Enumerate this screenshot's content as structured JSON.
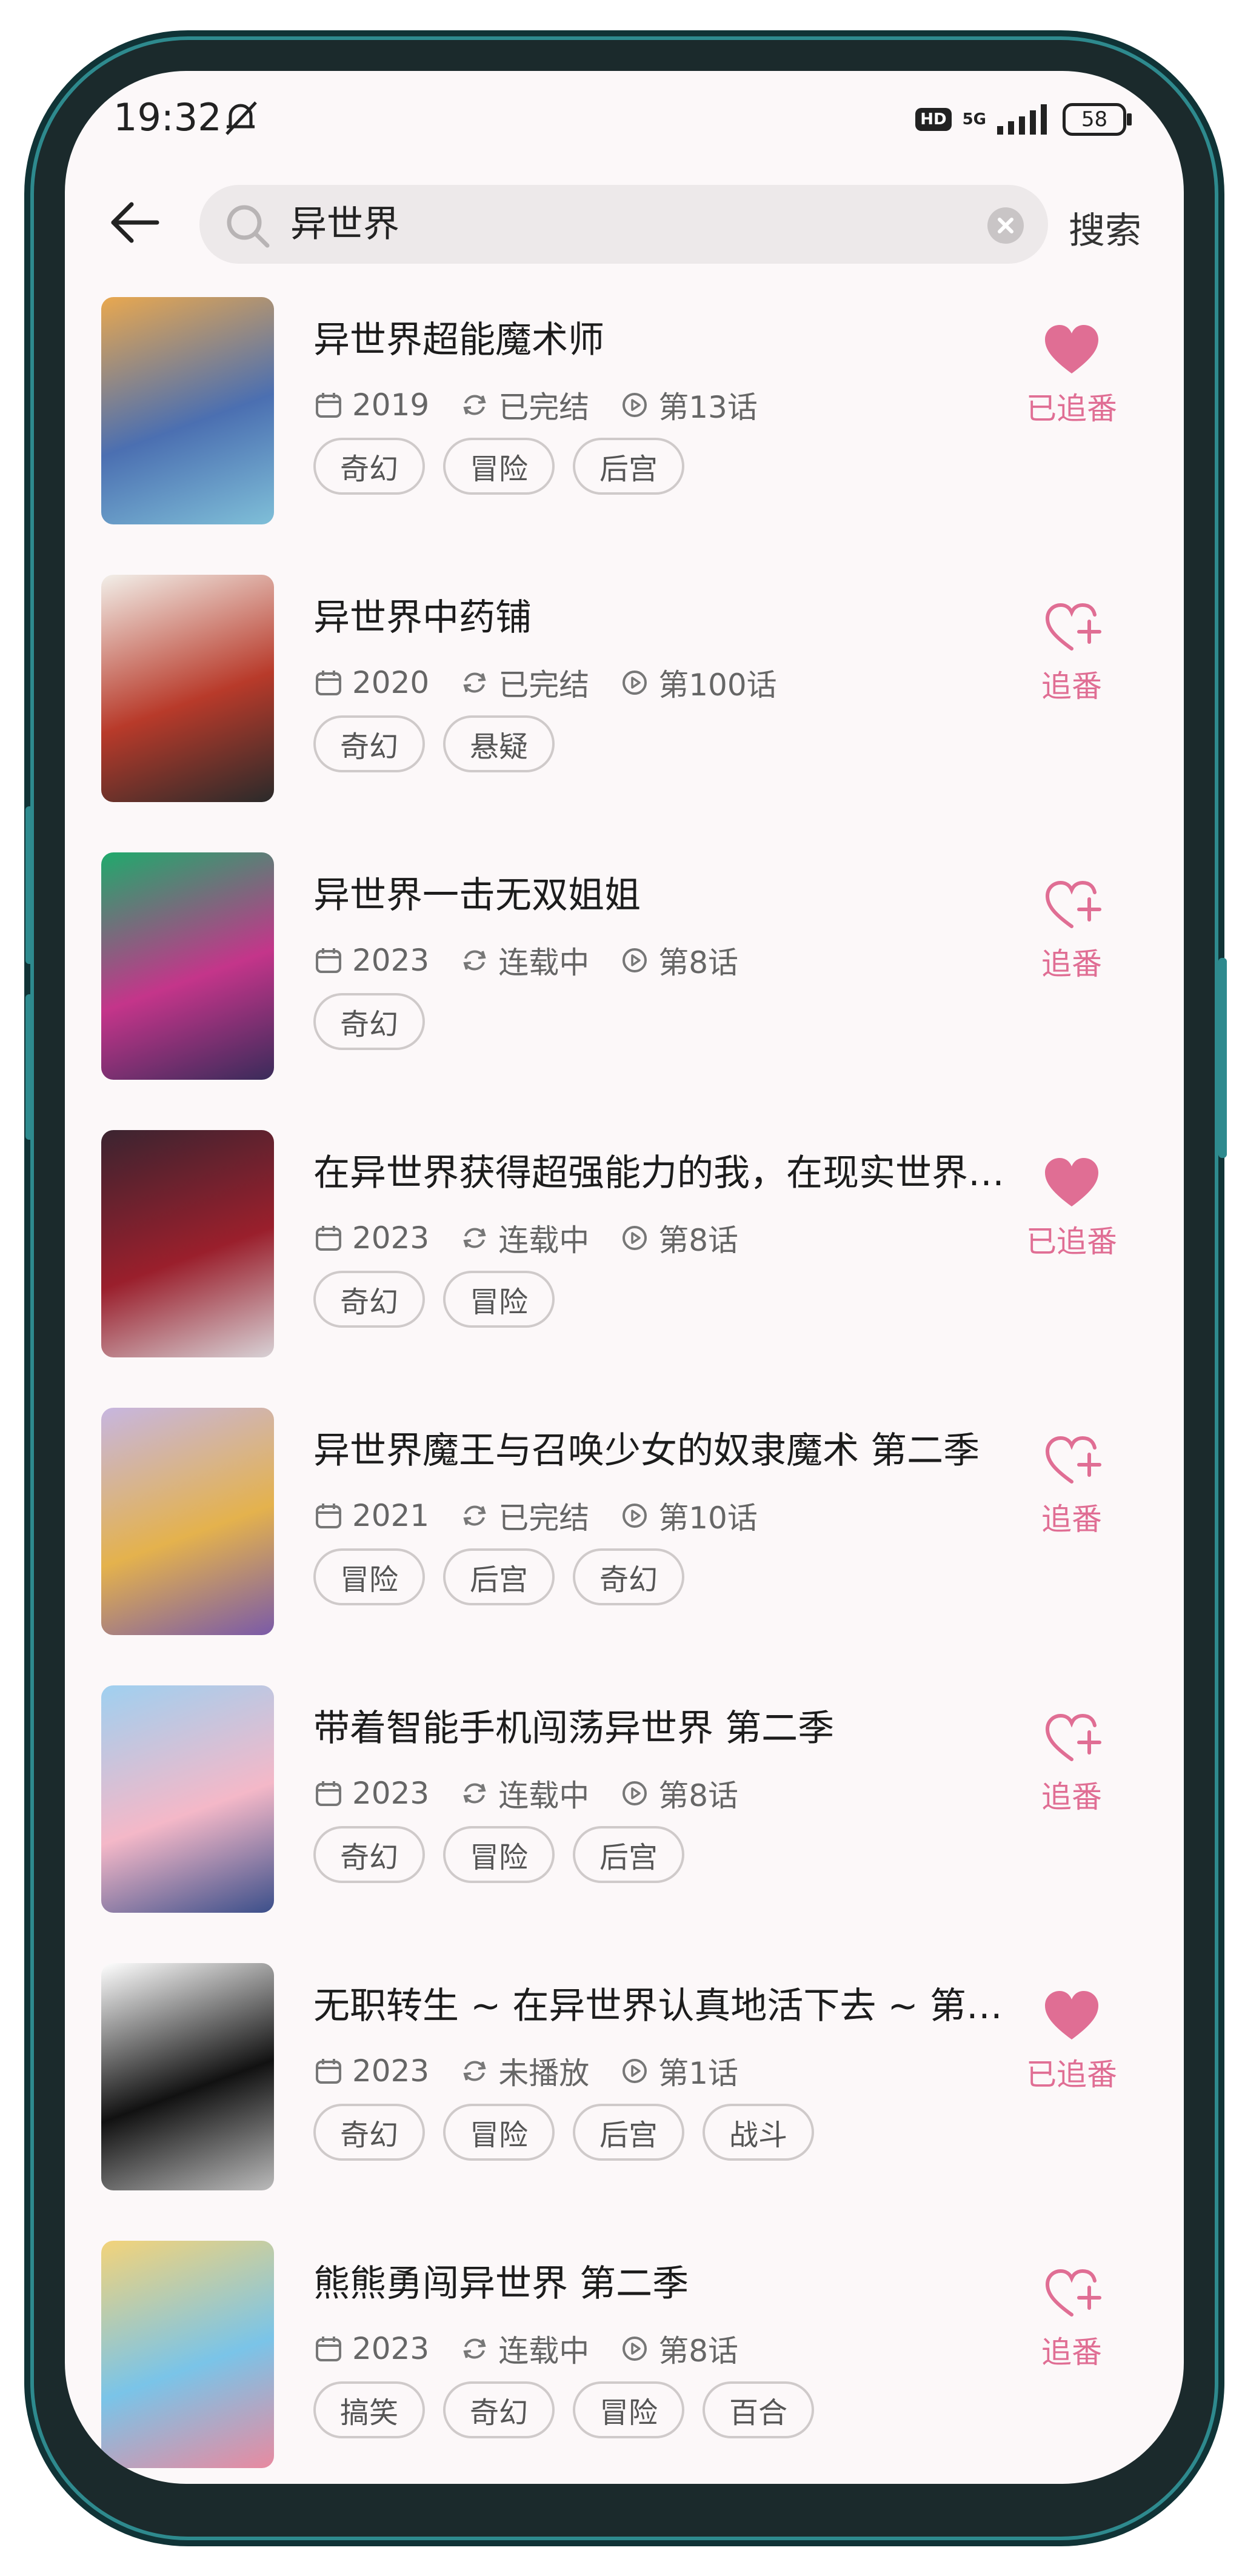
{
  "status_bar": {
    "time": "19:32",
    "network": "5G",
    "hd": "HD",
    "battery": "58"
  },
  "search": {
    "query": "异世界",
    "button": "搜索"
  },
  "accent_color": "#e06e94",
  "results": [
    {
      "title": "异世界超能魔术师",
      "year": "2019",
      "status": "已完结",
      "episode": "第13话",
      "tags": [
        "奇幻",
        "冒险",
        "后宫"
      ],
      "followed": true,
      "follow_label": "已追番",
      "cover_colors": [
        "#e9a84f",
        "#4b6fb1",
        "#7fbfd8"
      ]
    },
    {
      "title": "异世界中药铺",
      "year": "2020",
      "status": "已完结",
      "episode": "第100话",
      "tags": [
        "奇幻",
        "悬疑"
      ],
      "followed": false,
      "follow_label": "追番",
      "cover_colors": [
        "#f2efe9",
        "#b83a2a",
        "#2a2a2a"
      ]
    },
    {
      "title": "异世界一击无双姐姐",
      "year": "2023",
      "status": "连载中",
      "episode": "第8话",
      "tags": [
        "奇幻"
      ],
      "followed": false,
      "follow_label": "追番",
      "cover_colors": [
        "#1faa6c",
        "#c4358a",
        "#3a2b5a"
      ]
    },
    {
      "title": "在异世界获得超强能力的我，在现实世界照样无敌～等级提升改变人生命运～",
      "year": "2023",
      "status": "连载中",
      "episode": "第8话",
      "tags": [
        "奇幻",
        "冒险"
      ],
      "followed": true,
      "follow_label": "已追番",
      "cover_colors": [
        "#3b2430",
        "#9a1f2c",
        "#d8d2d6"
      ]
    },
    {
      "title": "异世界魔王与召唤少女的奴隶魔术 第二季",
      "year": "2021",
      "status": "已完结",
      "episode": "第10话",
      "tags": [
        "冒险",
        "后宫",
        "奇幻"
      ],
      "followed": false,
      "follow_label": "追番",
      "cover_colors": [
        "#c7b6e0",
        "#e4b24d",
        "#7a5aa8"
      ]
    },
    {
      "title": "带着智能手机闯荡异世界 第二季",
      "year": "2023",
      "status": "连载中",
      "episode": "第8话",
      "tags": [
        "奇幻",
        "冒险",
        "后宫"
      ],
      "followed": false,
      "follow_label": "追番",
      "cover_colors": [
        "#9fd0f0",
        "#f4b8c8",
        "#3b4f8a"
      ]
    },
    {
      "title": "无职转生 ~ 在异世界认真地活下去 ~ 第二季",
      "year": "2023",
      "status": "未播放",
      "episode": "第1话",
      "tags": [
        "奇幻",
        "冒险",
        "后宫",
        "战斗"
      ],
      "followed": true,
      "follow_label": "已追番",
      "cover_colors": [
        "#ffffff",
        "#111111",
        "#bbbbbb"
      ]
    },
    {
      "title": "熊熊勇闯异世界 第二季",
      "year": "2023",
      "status": "连载中",
      "episode": "第8话",
      "tags": [
        "搞笑",
        "奇幻",
        "冒险",
        "百合"
      ],
      "followed": false,
      "follow_label": "追番",
      "cover_colors": [
        "#f3d37a",
        "#7ac4e8",
        "#e88aa0"
      ]
    }
  ]
}
